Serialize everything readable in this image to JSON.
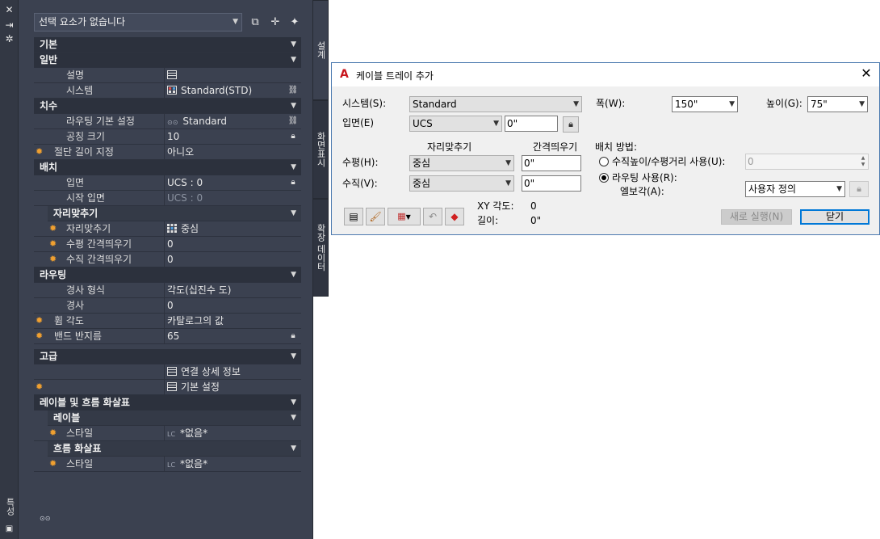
{
  "palette": {
    "strip_title": "특성",
    "selector_value": "선택 요소가 없습니다",
    "tabs": [
      "설계",
      "화면표시",
      "확장 데이터"
    ],
    "sections": {
      "basic": "기본",
      "general": "일반",
      "dimensions": "치수",
      "placement": "배치",
      "justification": "자리맞추기",
      "routing": "라우팅",
      "advanced": "고급",
      "labels_flow": "레이블 및 흐름 화살표",
      "labels": "레이블",
      "flow_arrows": "흐름 화살표"
    },
    "props": {
      "description": {
        "name": "설명",
        "value": ""
      },
      "system": {
        "name": "시스템",
        "value": "Standard(STD)"
      },
      "routing_pref": {
        "name": "라우팅 기본 설정",
        "value": "Standard"
      },
      "nominal_size": {
        "name": "공칭 크기",
        "value": "10"
      },
      "segment_length": {
        "name": "절단 길이 지정",
        "value": "아니오"
      },
      "elevation": {
        "name": "입면",
        "value": "UCS : 0"
      },
      "start_elevation": {
        "name": "시작 입면",
        "value": "UCS : 0"
      },
      "justify": {
        "name": "자리맞추기",
        "value": "중심"
      },
      "h_offset": {
        "name": "수평 간격띄우기",
        "value": "0"
      },
      "v_offset": {
        "name": "수직 간격띄우기",
        "value": "0"
      },
      "slope_format": {
        "name": "경사 형식",
        "value": "각도(십진수 도)"
      },
      "slope": {
        "name": "경사",
        "value": "0"
      },
      "bend_angle": {
        "name": "휨 각도",
        "value": "카탈로그의 값"
      },
      "bend_radius": {
        "name": "밴드 반지름",
        "value": "65"
      },
      "conn_details": {
        "value": "연결 상세 정보"
      },
      "default_settings": {
        "value": "기본 설정"
      },
      "label_style": {
        "name": "스타일",
        "value": "*없음*"
      },
      "flow_style": {
        "name": "스타일",
        "value": "*없음*"
      }
    }
  },
  "dialog": {
    "title": "케이블 트레이 추가",
    "system_label": "시스템(S):",
    "system_value": "Standard",
    "elevation_label": "입면(E)",
    "elevation_combo": "UCS",
    "elevation_value": "0\"",
    "width_label": "폭(W):",
    "width_value": "150\"",
    "height_label": "높이(G):",
    "height_value": "75\"",
    "justify_header": "자리맞추기",
    "offset_header": "간격띄우기",
    "horizontal_label": "수평(H):",
    "horizontal_justify": "중심",
    "horizontal_offset": "0\"",
    "vertical_label": "수직(V):",
    "vertical_justify": "중심",
    "vertical_offset": "0\"",
    "placement_label": "배치 방법:",
    "radio_rise_run": "수직높이/수평거리 사용(U):",
    "rise_run_value": "0",
    "radio_routing": "라우팅 사용(R):",
    "elbow_label": "엘보각(A):",
    "elbow_value": "사용자 정의",
    "xy_angle_label": "XY 각도:",
    "xy_angle_value": "0",
    "length_label": "길이:",
    "length_value": "0\"",
    "new_run_button": "새로 실행(N)",
    "close_button": "닫기"
  }
}
